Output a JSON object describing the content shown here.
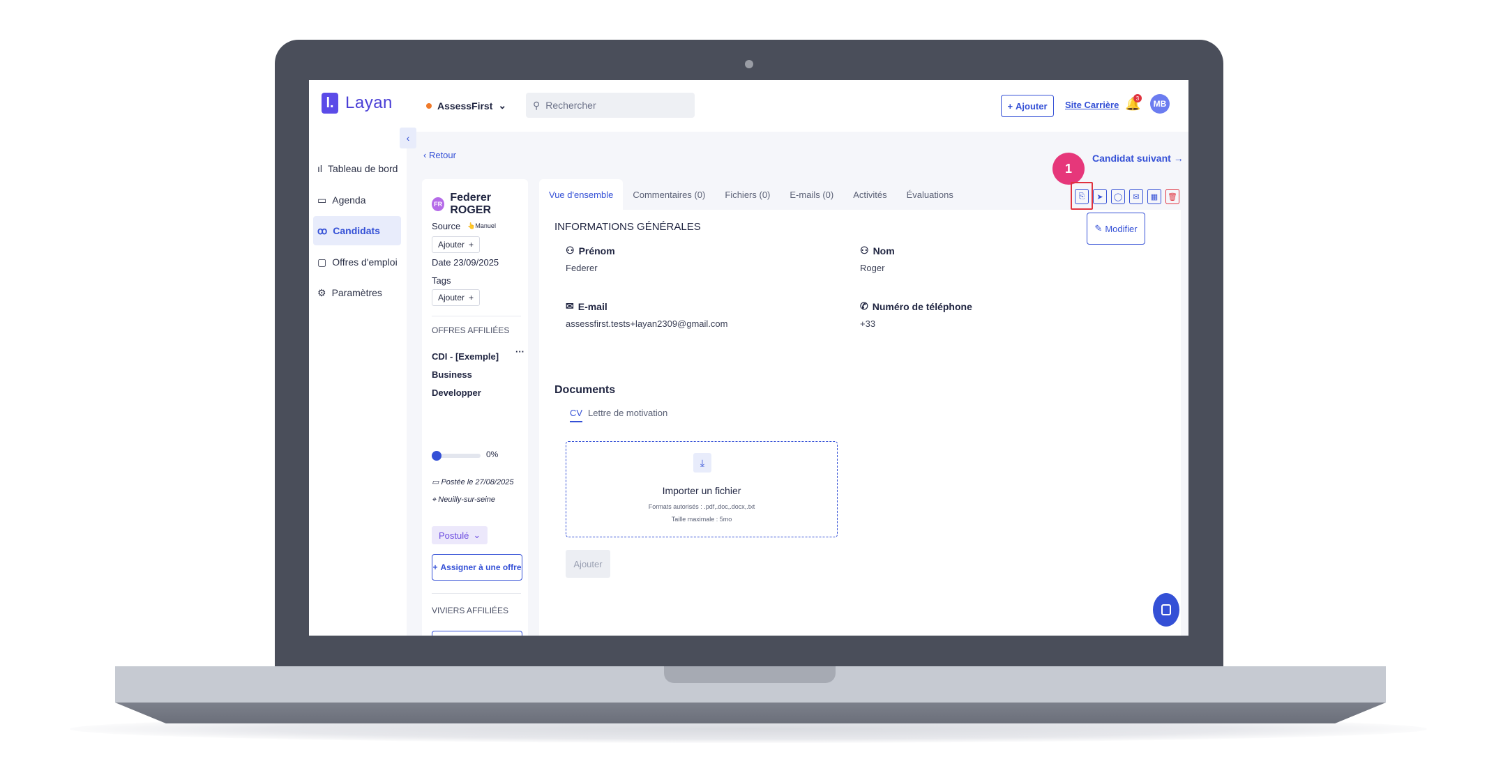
{
  "app": {
    "logo_text": "Layan",
    "logo_mark": "l.",
    "company": "AssessFirst"
  },
  "search": {
    "placeholder": "Rechercher"
  },
  "header": {
    "add_label": "Ajouter",
    "career_site": "Site Carrière",
    "notif_count": "3",
    "avatar_initials": "MB"
  },
  "sidebar": {
    "items": [
      {
        "label": "Tableau de bord",
        "icon": "bar-chart-icon"
      },
      {
        "label": "Agenda",
        "icon": "calendar-icon"
      },
      {
        "label": "Candidats",
        "icon": "users-icon"
      },
      {
        "label": "Offres d'emploi",
        "icon": "briefcase-icon"
      },
      {
        "label": "Paramètres",
        "icon": "gear-icon"
      }
    ]
  },
  "nav": {
    "back": "Retour",
    "next": "Candidat suivant"
  },
  "candidate": {
    "initials": "FR",
    "name": "Federer ROGER",
    "source_label": "Source",
    "source_value": "Manuel",
    "add_label": "Ajouter",
    "date_label": "Date",
    "date_value": "23/09/2025",
    "tags_label": "Tags",
    "offers_title": "OFFRES AFFILIÉES",
    "offer_name_1": "CDI - [Exemple]",
    "offer_name_2": "Business",
    "offer_name_3": "Developper",
    "offer_more": "···",
    "progress_text": "0%",
    "progress_value": 0,
    "posted": "Postée le 27/08/2025",
    "location": "Neuilly-sur-seine",
    "status": "Postulé",
    "assign": "Assigner à une offre",
    "pools_title": "VIVIERS AFFILIÉES"
  },
  "tabs": [
    "Vue d'ensemble",
    "Commentaires (0)",
    "Fichiers (0)",
    "E-mails (0)",
    "Activités",
    "Évaluations"
  ],
  "step_number": "1",
  "general": {
    "title": "INFORMATIONS GÉNÉRALES",
    "edit": "Modifier",
    "first_name_label": "Prénom",
    "first_name": "Federer",
    "last_name_label": "Nom",
    "last_name": "Roger",
    "email_label": "E-mail",
    "email": "assessfirst.tests+layan2309@gmail.com",
    "phone_label": "Numéro de téléphone",
    "phone": "+33"
  },
  "documents": {
    "title": "Documents",
    "tab_cv": "CV",
    "tab_letter": "Lettre de motivation",
    "import_title": "Importer un fichier",
    "formats": "Formats autorisés : .pdf,.doc,.docx,.txt",
    "max_size": "Taille maximale : 5mo",
    "add_button": "Ajouter"
  },
  "colors": {
    "accent": "#3450d6",
    "danger": "#e0323e",
    "step": "#e6377a"
  }
}
